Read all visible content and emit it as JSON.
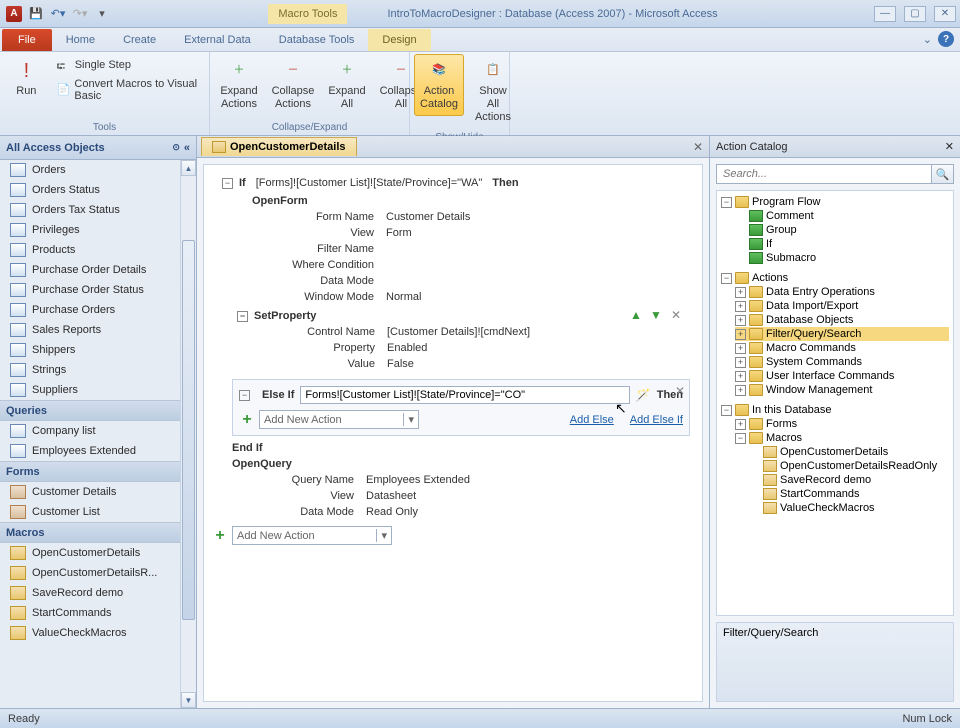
{
  "titlebar": {
    "macro_tools": "Macro Tools",
    "title": "IntroToMacroDesigner : Database (Access 2007) - Microsoft Access"
  },
  "tabs": {
    "file": "File",
    "items": [
      "Home",
      "Create",
      "External Data",
      "Database Tools"
    ],
    "contextual": "Design"
  },
  "ribbon": {
    "run": "Run",
    "single_step": "Single Step",
    "convert": "Convert Macros to Visual Basic",
    "tools_label": "Tools",
    "expand_actions": "Expand Actions",
    "collapse_actions": "Collapse Actions",
    "expand_all": "Expand All",
    "collapse_all": "Collapse All",
    "collapse_expand_label": "Collapse/Expand",
    "action_catalog": "Action Catalog",
    "show_all": "Show All Actions",
    "showhide_label": "Show/Hide"
  },
  "nav": {
    "header": "All Access Objects",
    "tables": [
      "Orders",
      "Orders Status",
      "Orders Tax Status",
      "Privileges",
      "Products",
      "Purchase Order Details",
      "Purchase Order Status",
      "Purchase Orders",
      "Sales Reports",
      "Shippers",
      "Strings",
      "Suppliers"
    ],
    "queries_label": "Queries",
    "queries": [
      "Company list",
      "Employees Extended"
    ],
    "forms_label": "Forms",
    "forms": [
      "Customer Details",
      "Customer List"
    ],
    "macros_label": "Macros",
    "macros": [
      "OpenCustomerDetails",
      "OpenCustomerDetailsR...",
      "SaveRecord demo",
      "StartCommands",
      "ValueCheckMacros"
    ]
  },
  "doc": {
    "tab": "OpenCustomerDetails"
  },
  "macro": {
    "if_kw": "If",
    "if_cond": "[Forms]![Customer List]![State/Province]=\"WA\"",
    "then": "Then",
    "openform": "OpenForm",
    "openform_props": {
      "form_name_k": "Form Name",
      "form_name_v": "Customer Details",
      "view_k": "View",
      "view_v": "Form",
      "filter_k": "Filter Name",
      "filter_v": "",
      "where_k": "Where Condition",
      "where_v": "",
      "datamode_k": "Data Mode",
      "datamode_v": "",
      "winmode_k": "Window Mode",
      "winmode_v": "Normal"
    },
    "setprop": "SetProperty",
    "setprop_props": {
      "control_k": "Control Name",
      "control_v": "[Customer Details]![cmdNext]",
      "prop_k": "Property",
      "prop_v": "Enabled",
      "value_k": "Value",
      "value_v": "False"
    },
    "elseif_kw": "Else If",
    "elseif_cond": "Forms![Customer List]![State/Province]=\"CO\"",
    "addnew": "Add New Action",
    "addelse": "Add Else",
    "addelseif": "Add Else If",
    "endif": "End If",
    "openquery": "OpenQuery",
    "openquery_props": {
      "qname_k": "Query Name",
      "qname_v": "Employees Extended",
      "view_k": "View",
      "view_v": "Datasheet",
      "datamode_k": "Data Mode",
      "datamode_v": "Read Only"
    }
  },
  "catalog": {
    "title": "Action Catalog",
    "search_ph": "Search...",
    "program_flow": "Program Flow",
    "pf_items": [
      "Comment",
      "Group",
      "If",
      "Submacro"
    ],
    "actions": "Actions",
    "action_items": [
      "Data Entry Operations",
      "Data Import/Export",
      "Database Objects",
      "Filter/Query/Search",
      "Macro Commands",
      "System Commands",
      "User Interface Commands",
      "Window Management"
    ],
    "inthisdb": "In this Database",
    "forms_node": "Forms",
    "macros_node": "Macros",
    "db_macros": [
      "OpenCustomerDetails",
      "OpenCustomerDetailsReadOnly",
      "SaveRecord demo",
      "StartCommands",
      "ValueCheckMacros"
    ],
    "desc": "Filter/Query/Search"
  },
  "status": {
    "ready": "Ready",
    "numlock": "Num Lock"
  }
}
